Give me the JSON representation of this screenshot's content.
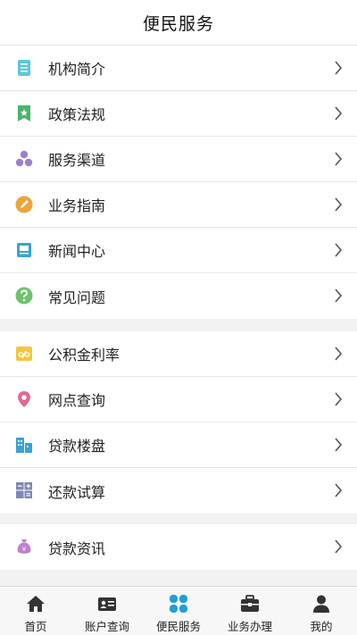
{
  "header": {
    "title": "便民服务"
  },
  "groups": [
    {
      "items": [
        {
          "label": "机构简介",
          "icon": "document-icon",
          "color": "#5bc8d8"
        },
        {
          "label": "政策法规",
          "icon": "bookmark-star-icon",
          "color": "#4cb36a"
        },
        {
          "label": "服务渠道",
          "icon": "hexagon-cluster-icon",
          "color": "#9b7fcf"
        },
        {
          "label": "业务指南",
          "icon": "pencil-circle-icon",
          "color": "#f0a33a"
        },
        {
          "label": "新闻中心",
          "icon": "newspaper-icon",
          "color": "#35a3d6"
        },
        {
          "label": "常见问题",
          "icon": "question-circle-icon",
          "color": "#6cc46a"
        }
      ]
    },
    {
      "items": [
        {
          "label": "公积金利率",
          "icon": "percent-tag-icon",
          "color": "#f2c73b"
        },
        {
          "label": "网点查询",
          "icon": "location-pin-icon",
          "color": "#e06a93"
        },
        {
          "label": "贷款楼盘",
          "icon": "buildings-icon",
          "color": "#3aa0d8"
        },
        {
          "label": "还款试算",
          "icon": "calculator-icon",
          "color": "#7f86b8"
        }
      ]
    },
    {
      "items": [
        {
          "label": "贷款资讯",
          "icon": "money-bag-icon",
          "color": "#c07ed0"
        }
      ]
    }
  ],
  "tabbar": {
    "tabs": [
      {
        "label": "首页",
        "icon": "home-icon",
        "active": false
      },
      {
        "label": "账户查询",
        "icon": "id-card-icon",
        "active": false
      },
      {
        "label": "便民服务",
        "icon": "grid-petal-icon",
        "active": true
      },
      {
        "label": "业务办理",
        "icon": "briefcase-icon",
        "active": false
      },
      {
        "label": "我的",
        "icon": "user-icon",
        "active": false
      }
    ],
    "active_color": "#1e9fd8",
    "inactive_color": "#333333"
  }
}
